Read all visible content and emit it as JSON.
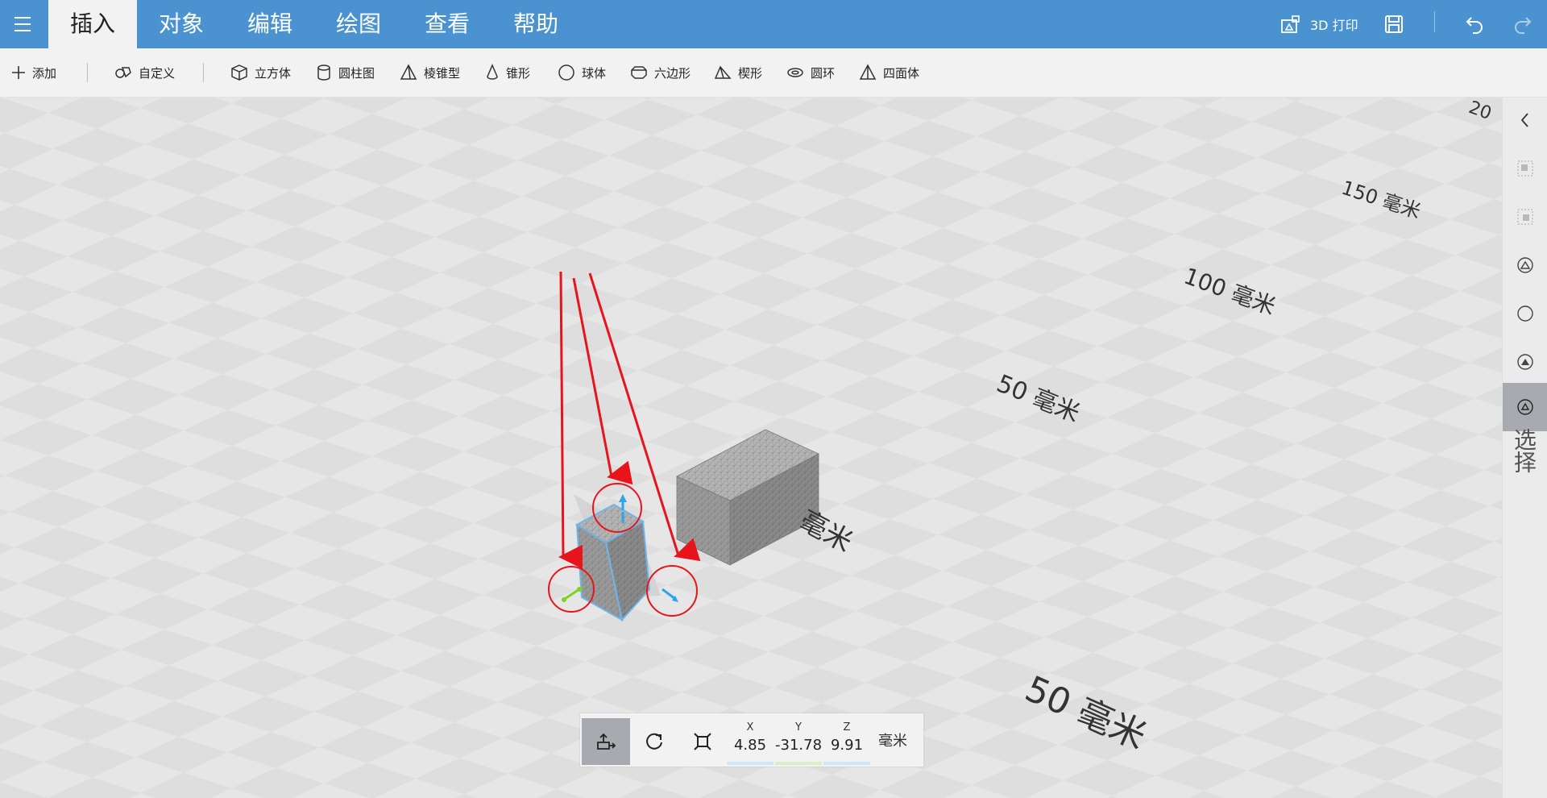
{
  "menubar": {
    "tabs": [
      "插入",
      "对象",
      "编辑",
      "绘图",
      "查看",
      "帮助"
    ],
    "active_tab": "插入",
    "print_label": "3D 打印",
    "colors": {
      "bar": "#4a93d0",
      "active_tab_bg": "#f2f2f2"
    }
  },
  "toolbar": {
    "add_label": "添加",
    "custom_label": "自定义",
    "shapes": [
      "立方体",
      "圆柱图",
      "棱锥型",
      "锥形",
      "球体",
      "六边形",
      "楔形",
      "圆环",
      "四面体"
    ]
  },
  "viewport": {
    "scale_labels": [
      "20",
      "150 毫米",
      "100 毫米",
      "50 毫米",
      "毫米",
      "50 毫米"
    ],
    "annotation_color": "#e8141c",
    "gizmo_colors": {
      "up": "#2aa7e8",
      "left": "#7ed321",
      "right": "#2aa7e8"
    }
  },
  "rightrail": {
    "select_label": "选择",
    "icons": [
      "chevron-left-icon",
      "group-icon",
      "ungroup-icon",
      "align-icon",
      "circle-icon",
      "mirror-icon",
      "select-icon"
    ]
  },
  "transform": {
    "axes": [
      "X",
      "Y",
      "Z"
    ],
    "values": [
      "4.85",
      "-31.78",
      "9.91"
    ],
    "unit": "毫米",
    "axis_colors": [
      "#cfe8f7",
      "#d7f0c8",
      "#cfe8f7"
    ]
  }
}
